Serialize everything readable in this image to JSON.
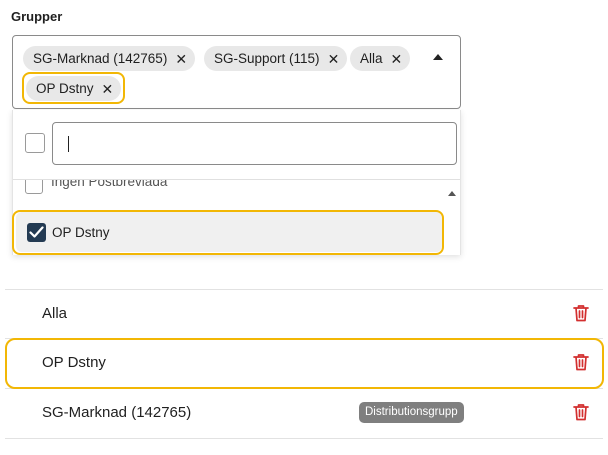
{
  "field": {
    "label": "Grupper"
  },
  "selected_chips": [
    {
      "label": "SG-Marknad (142765)"
    },
    {
      "label": "SG-Support (115)"
    },
    {
      "label": "Alla"
    },
    {
      "label": "OP Dstny"
    }
  ],
  "chip_remove_icon": "close-icon",
  "dropdown": {
    "search_value": "",
    "options": [
      {
        "label": "Ingen Postbrevlåda",
        "checked": false
      },
      {
        "label": "OP Dstny",
        "checked": true
      }
    ]
  },
  "groups_list": [
    {
      "name": "Alla",
      "badge": ""
    },
    {
      "name": "OP Dstny",
      "badge": ""
    },
    {
      "name": "SG-Marknad (142765)",
      "badge": "Distributionsgrupp"
    }
  ],
  "colors": {
    "highlight": "#f2b705",
    "checkbox_checked": "#243b53",
    "delete_icon": "#d32f2f",
    "badge_bg": "#7f7f7f"
  }
}
